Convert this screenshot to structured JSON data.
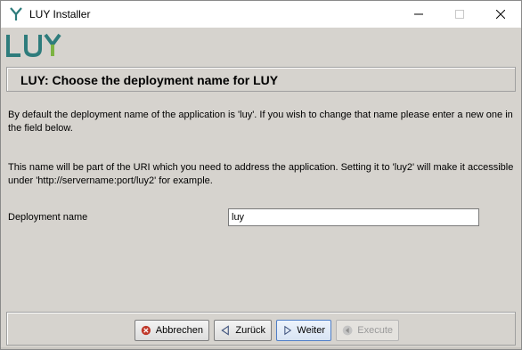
{
  "window": {
    "title": "LUY Installer",
    "icon": "luy-y-icon"
  },
  "logo": {
    "text": "LUY",
    "color": "#2e7c7c"
  },
  "header": {
    "title": "LUY: Choose the deployment name for LUY"
  },
  "content": {
    "paragraph1": "By default the deployment name of the application is 'luy'. If you wish to change that name please enter a new one in the field below.",
    "paragraph2": "This name will be part of the URI which you need to address the application. Setting it to 'luy2' will make it accessible under 'http://servername:port/luy2' for example."
  },
  "form": {
    "deployment_label": "Deployment name",
    "deployment_value": "luy"
  },
  "buttons": {
    "cancel": "Abbrechen",
    "back": "Zurück",
    "next": "Weiter",
    "execute": "Execute"
  },
  "colors": {
    "window_bg": "#d6d3ce",
    "cancel_icon": "#c0392b",
    "back_icon": "#3b4f7a",
    "next_icon": "#3b4f7a"
  }
}
